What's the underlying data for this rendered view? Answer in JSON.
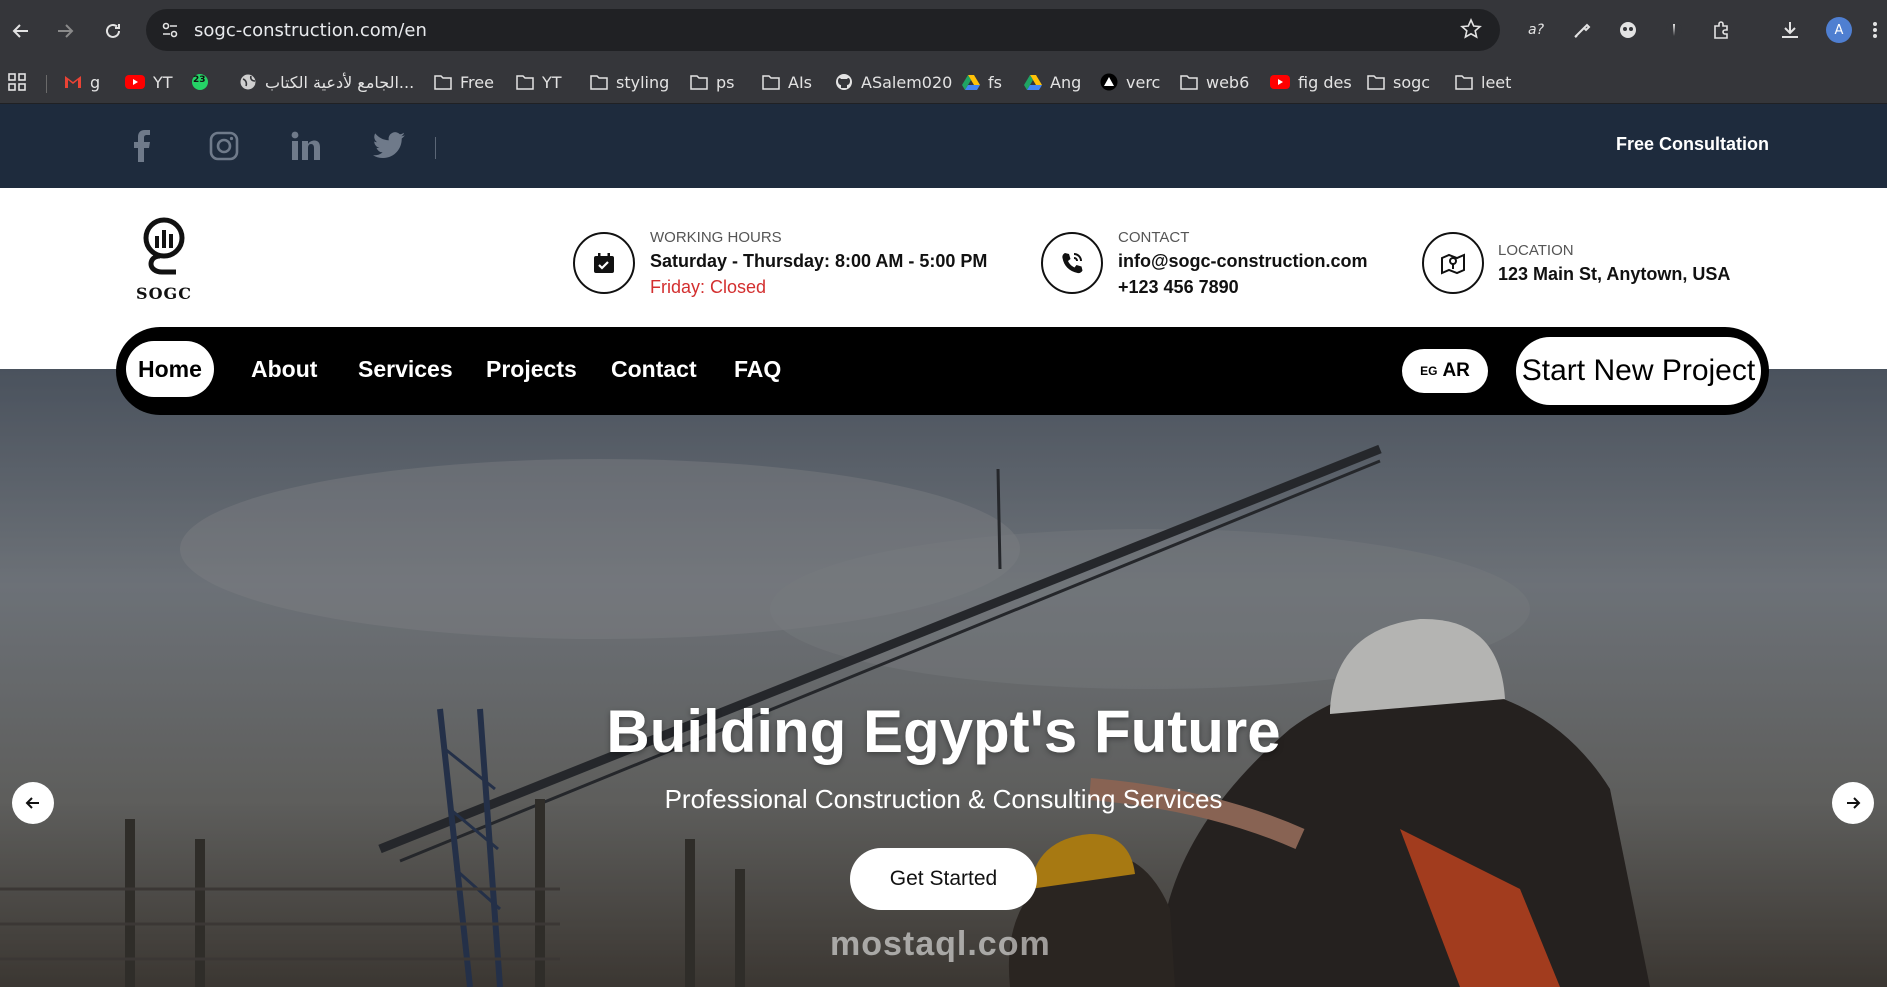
{
  "browser": {
    "url": "sogc-construction.com/en",
    "profile_initial": "A",
    "ext_translate_label": "a?",
    "bookmarks": [
      {
        "icon": "gmail-icon",
        "label": "g"
      },
      {
        "icon": "youtube-icon",
        "label": "YT"
      },
      {
        "icon": "whatsapp-icon",
        "label": "",
        "badge": "23"
      },
      {
        "icon": "globe-icon",
        "label": "الجامع لأدعية الكتاب..."
      },
      {
        "icon": "folder-icon",
        "label": "Free"
      },
      {
        "icon": "folder-icon",
        "label": "YT"
      },
      {
        "icon": "folder-icon",
        "label": "styling"
      },
      {
        "icon": "folder-icon",
        "label": "ps"
      },
      {
        "icon": "folder-icon",
        "label": "AIs"
      },
      {
        "icon": "github-icon",
        "label": "ASalem020"
      },
      {
        "icon": "drive-icon",
        "label": "fs"
      },
      {
        "icon": "drive-icon",
        "label": "Ang"
      },
      {
        "icon": "vercel-icon",
        "label": "verc"
      },
      {
        "icon": "folder-icon",
        "label": "web6"
      },
      {
        "icon": "youtube-icon",
        "label": "fig des"
      },
      {
        "icon": "folder-icon",
        "label": "sogc"
      },
      {
        "icon": "folder-icon",
        "label": "leet"
      }
    ]
  },
  "topbar": {
    "social": [
      "facebook-icon",
      "instagram-icon",
      "linkedin-icon",
      "twitter-icon"
    ],
    "cta": "Free Consultation"
  },
  "brand": {
    "name": "SOGC"
  },
  "info": {
    "hours": {
      "label": "WORKING HOURS",
      "value": "Saturday - Thursday: 8:00 AM - 5:00 PM",
      "closed": "Friday: Closed"
    },
    "contact": {
      "label": "CONTACT",
      "email": "info@sogc-construction.com",
      "phone": "+123 456 7890"
    },
    "location": {
      "label": "LOCATION",
      "value": "123 Main St, Anytown, USA"
    }
  },
  "nav": {
    "items": [
      "Home",
      "About",
      "Services",
      "Projects",
      "Contact",
      "FAQ"
    ],
    "lang_flag": "EG",
    "lang": "AR",
    "start": "Start New Project"
  },
  "hero": {
    "title": "Building Egypt's Future",
    "subtitle": "Professional Construction & Consulting Services",
    "cta": "Get Started",
    "watermark": "mostaql.com"
  },
  "colors": {
    "topbar": "#1e2b3d",
    "accent_red": "#d32f2f",
    "nav": "#000000"
  }
}
